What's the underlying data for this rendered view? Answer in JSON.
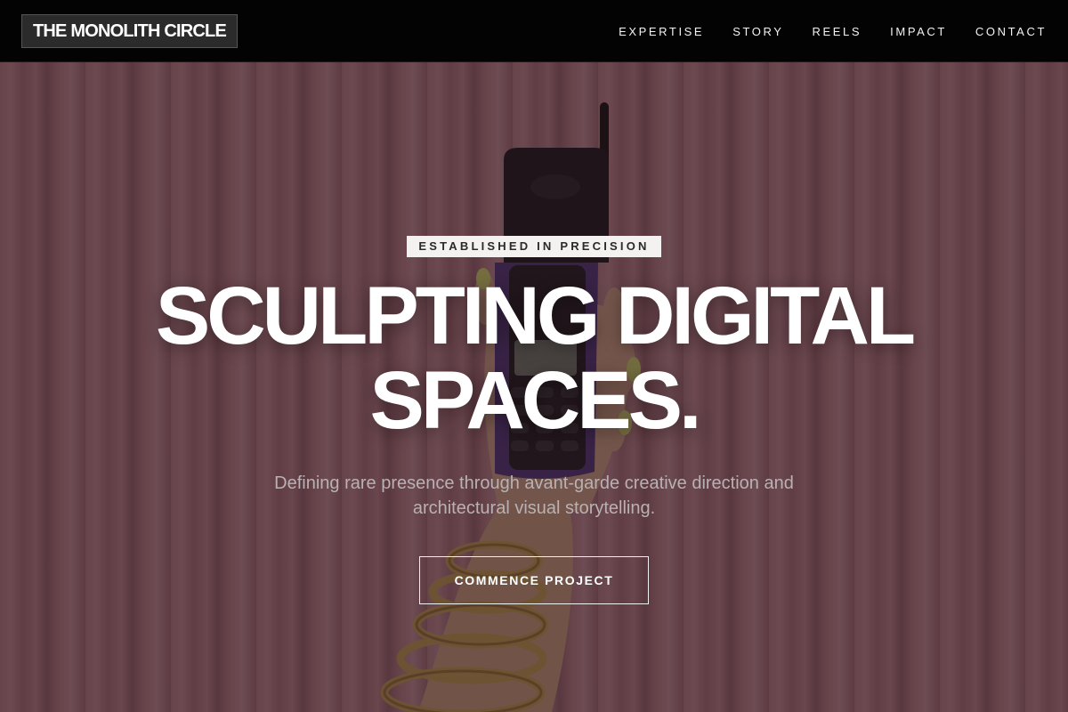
{
  "header": {
    "brand": "THE MONOLITH CIRCLE",
    "nav": [
      "EXPERTISE",
      "STORY",
      "REELS",
      "IMPACT",
      "CONTACT"
    ]
  },
  "hero": {
    "badge": "ESTABLISHED IN PRECISION",
    "headline_line1": "SCULPTING DIGITAL",
    "headline_line2": "SPACES.",
    "subtitle": "Defining rare presence through avant-garde creative direction and architectural visual storytelling.",
    "cta_label": "COMMENCE PROJECT",
    "background_image": "hand-holding-vintage-cell-phone-against-pink-curtain"
  },
  "colors": {
    "header_bg": "#030303",
    "brand_box_bg": "#2b2b2b",
    "overlay": "#200e14",
    "curtain_pink": "#c58f95",
    "badge_bg": "#f4f1f1",
    "headline": "#ffffff",
    "subtitle": "#b9b1b3"
  }
}
